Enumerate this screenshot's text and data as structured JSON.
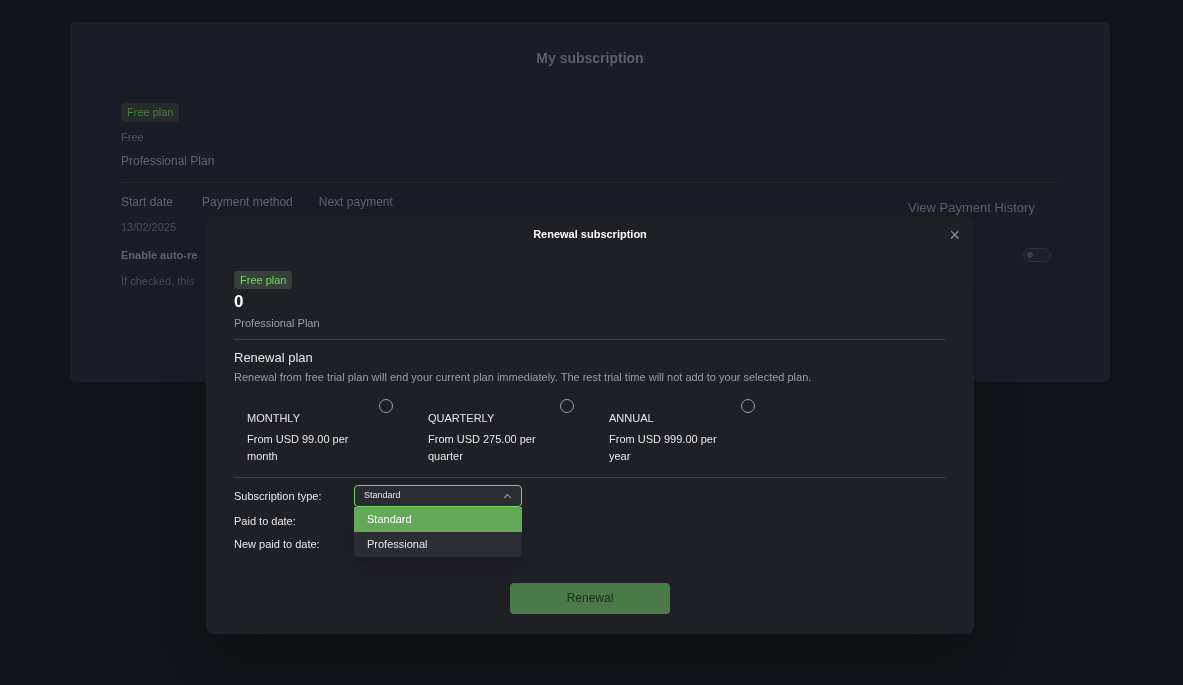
{
  "page": {
    "title": "My subscription",
    "badge": "Free plan",
    "price": "Free",
    "plan_name": "Professional Plan",
    "columns": [
      {
        "label": "Start date",
        "value": "13/02/2025"
      },
      {
        "label": "Payment method"
      },
      {
        "label": "Next payment"
      }
    ],
    "auto_renew": {
      "label": "Enable auto-re",
      "description": "If checked, this",
      "on": false
    },
    "history_link": "View Payment History"
  },
  "dialog": {
    "title": "Renewal subscription",
    "close": "×",
    "badge": "Free plan",
    "price": "0",
    "plan_name": "Professional Plan",
    "section_title": "Renewal plan",
    "section_note": "Renewal from free trial plan will end your current plan immediately. The rest trial time will not add to your selected plan.",
    "plans": [
      {
        "name": "MONTHLY",
        "price": "From USD 99.00 per month",
        "selected": false
      },
      {
        "name": "QUARTERLY",
        "price": "From USD 275.00 per quarter",
        "selected": false
      },
      {
        "name": "ANNUAL",
        "price": "From USD 999.00 per year",
        "selected": false
      }
    ],
    "subscription_type": {
      "label": "Subscription type:",
      "value": "Standard",
      "expanded": true,
      "options": [
        {
          "label": "Standard",
          "selected": true
        },
        {
          "label": "Professional",
          "selected": false
        }
      ]
    },
    "fields": [
      {
        "label": "Paid to date:"
      },
      {
        "label": "New paid to date:"
      }
    ],
    "button": "Renewal"
  }
}
